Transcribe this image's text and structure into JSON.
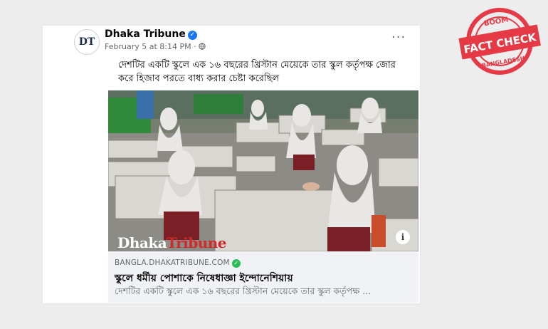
{
  "post": {
    "page_name": "Dhaka Tribune",
    "avatar_text": "DT",
    "timestamp": "February 5 at 8:14 PM",
    "separator": "·",
    "more_label": "···",
    "text": "দেশটির একটি স্কুলে এক ১৬ বছরের খ্রিস্টান মেয়েকে তার স্কুল কর্তৃপক্ষ জোর করে হিজাব পরতে বাধ্য করার চেষ্টা করেছিল",
    "photo_watermark_left": "Dhaka",
    "photo_watermark_right": "Tribune",
    "info_label": "i"
  },
  "link_preview": {
    "domain": "BANGLA.DHAKATRIBUNE.COM",
    "title": "স্কুলে ধর্মীয় পোশাকে নিষেধাজ্ঞা ইন্দোনেশিয়ায়",
    "description": "দেশটির একটি স্কুলে এক ১৬ বছরের খ্রিস্টান মেয়েকে তার স্কুল কর্তৃপক্ষ ..."
  },
  "stamp": {
    "top_text": "BOOM",
    "main_text": "FACT CHECK",
    "bottom_text": "BANGLADESH",
    "color": "#e63946"
  },
  "icons": {
    "verified": "verified-badge-icon",
    "globe": "globe-icon",
    "link_verified": "green-check-icon"
  }
}
